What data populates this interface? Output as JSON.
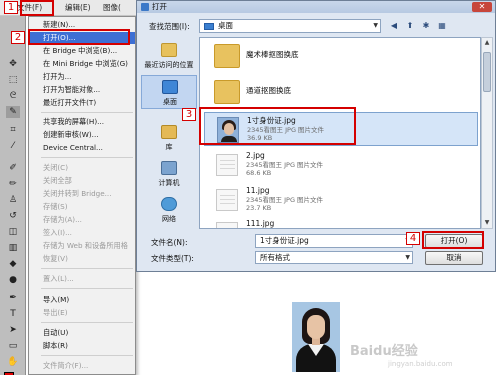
{
  "ps_menubar": {
    "file": "文件(F)",
    "edit": "编辑(E)",
    "image": "图像("
  },
  "file_menu": {
    "items": [
      {
        "label": "新建(N)...",
        "disabled": false
      },
      {
        "label": "打开(O)...",
        "disabled": false,
        "highlighted": true
      },
      {
        "label": "在 Bridge 中浏览(B)...",
        "disabled": false
      },
      {
        "label": "在 Mini Bridge 中浏览(G)",
        "disabled": false
      },
      {
        "label": "打开为...",
        "disabled": false
      },
      {
        "label": "打开为智能对象...",
        "disabled": false
      },
      {
        "label": "最近打开文件(T)",
        "disabled": false
      },
      {
        "label": "共享我的屏幕(H)...",
        "disabled": false
      },
      {
        "label": "创建新审核(W)...",
        "disabled": false
      },
      {
        "label": "Device Central...",
        "disabled": false
      },
      {
        "label": "关闭(C)",
        "disabled": true
      },
      {
        "label": "关闭全部",
        "disabled": true
      },
      {
        "label": "关闭并转到 Bridge...",
        "disabled": true
      },
      {
        "label": "存储(S)",
        "disabled": true
      },
      {
        "label": "存储为(A)...",
        "disabled": true
      },
      {
        "label": "签入(I)...",
        "disabled": true
      },
      {
        "label": "存储为 Web 和设备所用格",
        "disabled": true
      },
      {
        "label": "恢复(V)",
        "disabled": true
      },
      {
        "label": "置入(L)...",
        "disabled": true
      },
      {
        "label": "导入(M)",
        "disabled": false
      },
      {
        "label": "导出(E)",
        "disabled": true
      },
      {
        "label": "自动(U)",
        "disabled": false
      },
      {
        "label": "脚本(R)",
        "disabled": false
      },
      {
        "label": "文件简介(F)...",
        "disabled": true
      }
    ]
  },
  "dialog": {
    "title": "打开",
    "look_in_label": "查找范围(I):",
    "look_in_value": "桌面",
    "places": [
      "最近访问的位置",
      "桌面",
      "库",
      "计算机",
      "网络"
    ],
    "files": [
      {
        "name": "魔术棒抠图换底",
        "desc": "",
        "size": "",
        "kind": "folder"
      },
      {
        "name": "通道抠图换底",
        "desc": "",
        "size": "",
        "kind": "folder"
      },
      {
        "name": "1寸身份证.jpg",
        "desc": "2345看图王 JPG 图片文件",
        "size": "36.9 KB",
        "kind": "photo"
      },
      {
        "name": "2.jpg",
        "desc": "2345看图王 JPG 图片文件",
        "size": "68.6 KB",
        "kind": "doc"
      },
      {
        "name": "11.jpg",
        "desc": "2345看图王 JPG 图片文件",
        "size": "23.7 KB",
        "kind": "doc"
      },
      {
        "name": "111.jpg",
        "desc": "",
        "size": "",
        "kind": "doc"
      }
    ],
    "filename_label": "文件名(N):",
    "filename_value": "1寸身份证.jpg",
    "filetype_label": "文件类型(T):",
    "filetype_value": "所有格式",
    "open_button": "打开(O)",
    "cancel_button": "取消"
  },
  "steps": [
    "1",
    "2",
    "3",
    "4"
  ],
  "accent_color": "#d40000",
  "highlight_color": "#3d6fd4",
  "watermark": "Baidu经验",
  "watermark_sub": "jingyan.baidu.com"
}
